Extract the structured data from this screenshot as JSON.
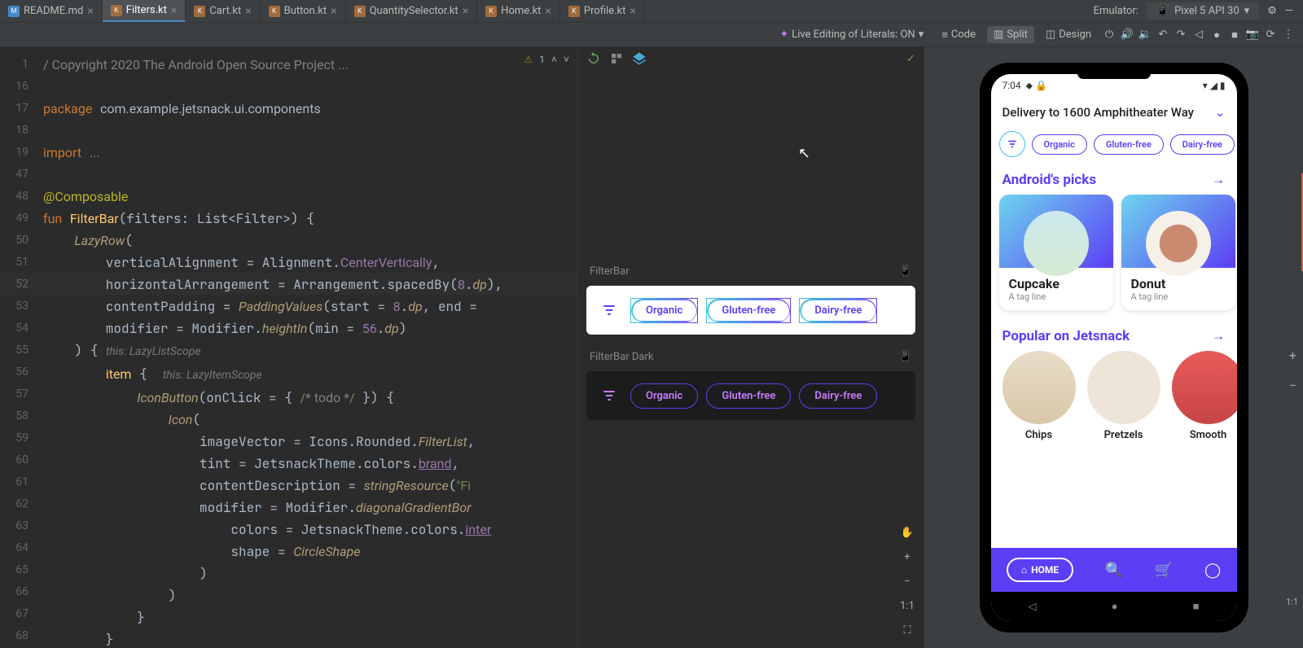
{
  "tabs": [
    {
      "label": "README.md",
      "icon": "md"
    },
    {
      "label": "Filters.kt",
      "icon": "kt",
      "active": true
    },
    {
      "label": "Cart.kt",
      "icon": "kt"
    },
    {
      "label": "Button.kt",
      "icon": "kt"
    },
    {
      "label": "QuantitySelector.kt",
      "icon": "kt"
    },
    {
      "label": "Home.kt",
      "icon": "kt"
    },
    {
      "label": "Profile.kt",
      "icon": "kt"
    }
  ],
  "emulator": {
    "label": "Emulator:",
    "device": "Pixel 5 API 30"
  },
  "toolbar": {
    "live": "Live Editing of Literals: ON",
    "code": "Code",
    "split": "Split",
    "design": "Design"
  },
  "gutter": [
    "1",
    "16",
    "17",
    "18",
    "19",
    "47",
    "48",
    "49",
    "50",
    "51",
    "52",
    "53",
    "54",
    "55",
    "56",
    "57",
    "58",
    "59",
    "60",
    "61",
    "62",
    "63",
    "64",
    "65",
    "66",
    "67",
    "68"
  ],
  "warnings": "1",
  "previews": {
    "light": "FilterBar",
    "dark": "FilterBar Dark",
    "chips": [
      "Organic",
      "Gluten-free",
      "Dairy-free"
    ]
  },
  "controls": {
    "ratio": "1:1"
  },
  "phone": {
    "time": "7:04",
    "delivery": "Delivery to 1600 Amphitheater Way",
    "chips": [
      "Organic",
      "Gluten-free",
      "Dairy-free"
    ],
    "s1": "Android's picks",
    "cards": [
      {
        "t": "Cupcake",
        "s": "A tag line"
      },
      {
        "t": "Donut",
        "s": "A tag line"
      }
    ],
    "s2": "Popular on Jetsnack",
    "circles": [
      "Chips",
      "Pretzels",
      "Smooth"
    ],
    "home": "HOME"
  },
  "eratio": "1:1"
}
